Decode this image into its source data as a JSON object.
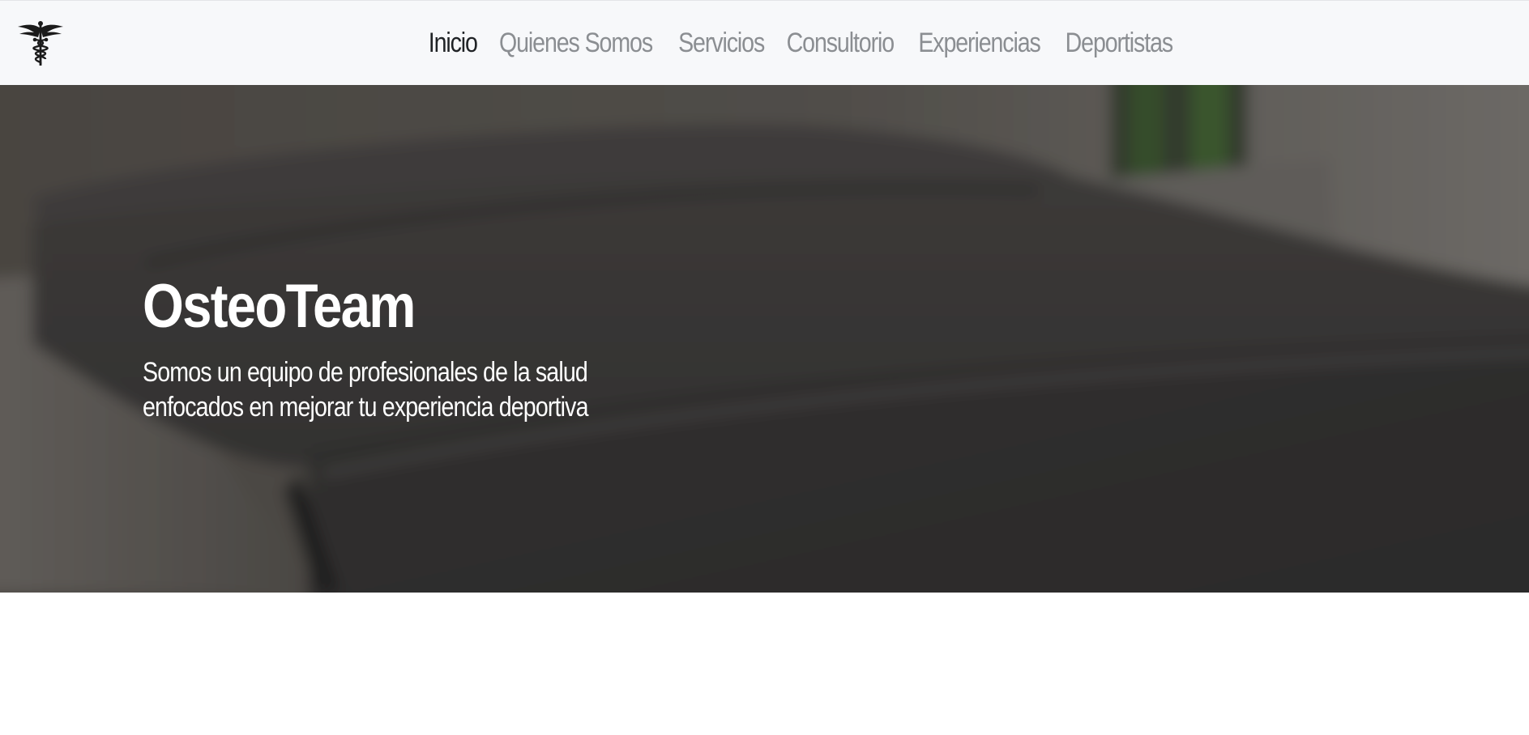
{
  "navbar": {
    "logo_icon": "caduceus-icon",
    "links": [
      {
        "label": "Inicio",
        "active": true
      },
      {
        "label": "Quienes Somos",
        "active": false
      },
      {
        "label": "Servicios",
        "active": false
      },
      {
        "label": "Consultorio",
        "active": false
      },
      {
        "label": "Experiencias",
        "active": false
      },
      {
        "label": "Deportistas",
        "active": false
      }
    ]
  },
  "hero": {
    "title": "OsteoTeam",
    "subtitle_line1": "Somos un equipo de profesionales de la salud",
    "subtitle_line2": "enfocados en mejorar tu experiencia deportiva",
    "background_icon": "massage-table-photo"
  },
  "colors": {
    "navbar_bg": "#f7f8fa",
    "nav_active": "#202326",
    "nav_inactive": "#8b8e92",
    "hero_text": "#ffffff"
  }
}
